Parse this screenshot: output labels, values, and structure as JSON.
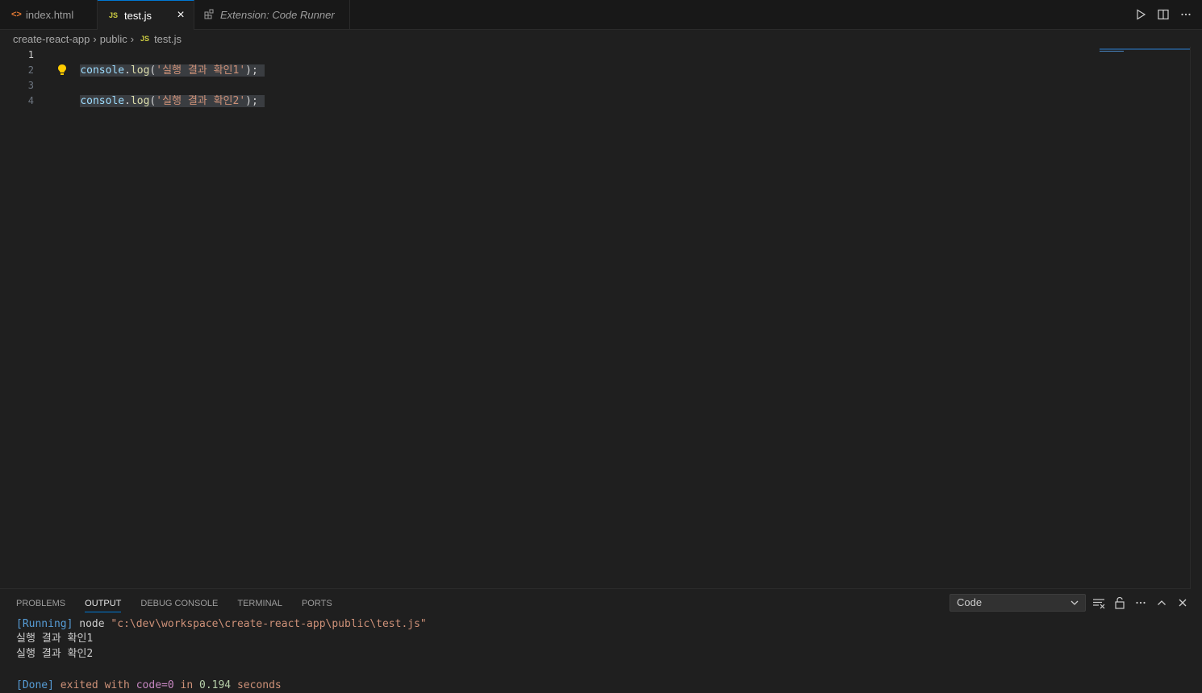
{
  "tabs": [
    {
      "label": "index.html",
      "icon": "html-icon"
    },
    {
      "label": "test.js",
      "icon": "js-icon",
      "active": true
    },
    {
      "label": "Extension: Code Runner",
      "icon": "extension-icon"
    }
  ],
  "js_badge": "JS",
  "breadcrumb": {
    "parts": [
      "create-react-app",
      "public",
      "test.js"
    ]
  },
  "editor": {
    "line_numbers": [
      "1",
      "2",
      "3",
      "4"
    ],
    "lines": [
      {
        "obj": "console",
        "dot": ".",
        "fn": "log",
        "open": "(",
        "str": "'실행 결과 확인1'",
        "close": ");"
      },
      {
        "obj": "console",
        "dot": ".",
        "fn": "log",
        "open": "(",
        "str": "'실행 결과 확인2'",
        "close": ");"
      }
    ]
  },
  "panel": {
    "tabs": [
      "PROBLEMS",
      "OUTPUT",
      "DEBUG CONSOLE",
      "TERMINAL",
      "PORTS"
    ],
    "active_tab": "OUTPUT",
    "channel": "Code",
    "output": {
      "running_tag": "[Running]",
      "running_cmd": " node ",
      "running_path": "\"c:\\dev\\workspace\\create-react-app\\public\\test.js\"",
      "line1": "실행 결과 확인1",
      "line2": "실행 결과 확인2",
      "done_tag": "[Done]",
      "exited": " exited with ",
      "code": "code=0",
      "in": " in ",
      "seconds_value": "0.194",
      "seconds": " seconds"
    }
  },
  "colors": {
    "accent": "#0078d4",
    "background": "#1f1f1f",
    "tabbar": "#181818"
  }
}
